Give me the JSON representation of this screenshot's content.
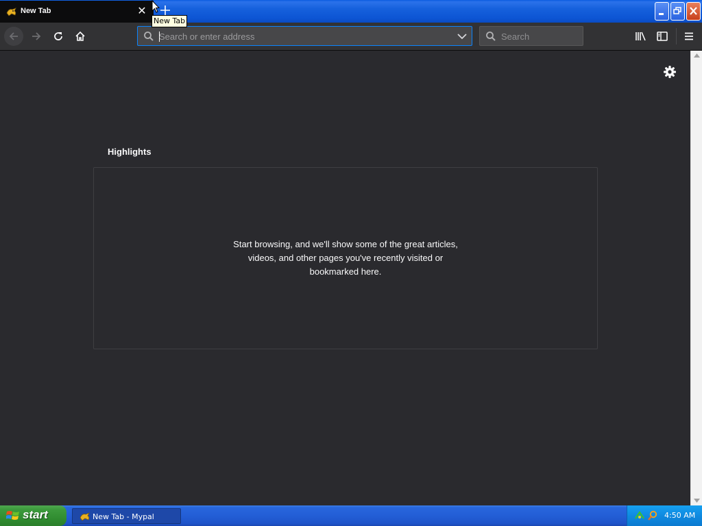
{
  "window": {
    "tab_title": "New Tab",
    "tooltip": "New Tab"
  },
  "toolbar": {
    "url_placeholder": "Search or enter address",
    "search_placeholder": "Search"
  },
  "content": {
    "highlights_title": "Highlights",
    "empty_message": "Start browsing, and we'll show some of the great articles, videos, and other pages you've recently visited or bookmarked here."
  },
  "taskbar": {
    "start_label": "start",
    "task_label": "New Tab - Mypal",
    "clock": "4:50 AM"
  },
  "colors": {
    "accent": "#0a84ff",
    "content_bg": "#2a2a2e",
    "toolbar_bg": "#323234",
    "xp_blue": "#235ed6",
    "xp_green": "#3c9a3c"
  },
  "icons": [
    "mypal-logo-icon",
    "close-icon",
    "plus-icon",
    "back-arrow-icon",
    "forward-arrow-icon",
    "reload-icon",
    "home-icon",
    "search-icon",
    "chevron-down-icon",
    "library-icon",
    "sidebar-icon",
    "hamburger-menu-icon",
    "gear-icon",
    "windows-logo-icon"
  ]
}
